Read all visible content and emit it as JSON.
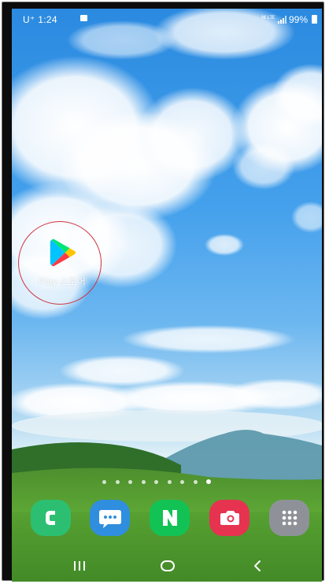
{
  "status_bar": {
    "carrier_time": "U⁺ 1:24",
    "network": "ᴺ⁽ ᴸᵀᴱ",
    "battery_percent": "99%"
  },
  "home": {
    "apps": [
      {
        "label": "Play 스토어",
        "icon": "play-store-icon"
      }
    ],
    "page_indicator": {
      "count": 9,
      "active_index": 8
    }
  },
  "dock": [
    {
      "name": "phone-app",
      "icon": "phone-icon",
      "color": "#2dbd73",
      "glyph": "C"
    },
    {
      "name": "messages-app",
      "icon": "chat-bubble-icon",
      "color": "#3a8fd9"
    },
    {
      "name": "naver-app",
      "icon": "naver-n-icon",
      "color": "#12c154",
      "glyph": "N"
    },
    {
      "name": "camera-app",
      "icon": "camera-icon",
      "color": "#e8334f"
    },
    {
      "name": "app-drawer",
      "icon": "grid-icon",
      "color": "#8e9399"
    }
  ],
  "nav_bar": {
    "recents": "recents-icon",
    "home": "home-icon",
    "back": "back-icon"
  }
}
